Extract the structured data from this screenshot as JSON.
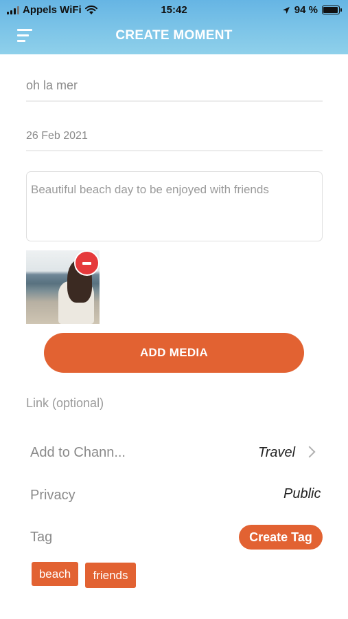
{
  "status_bar": {
    "carrier": "Appels WiFi",
    "time": "15:42",
    "battery": "94 %",
    "battery_level": 0.94
  },
  "header": {
    "title": "CREATE MOMENT",
    "menu_icon": "hamburger-menu-icon",
    "background_color": "#74bde6"
  },
  "form": {
    "title_value": "oh la mer",
    "date_value": "26 Feb 2021",
    "description_value": "Beautiful beach day to be enjoyed with friends",
    "media": {
      "thumbnail": "beach-photo",
      "remove_icon": "minus-circle-icon"
    },
    "add_media_label": "ADD MEDIA",
    "link_placeholder": "Link (optional)"
  },
  "settings": {
    "channel_label": "Add to Chann...",
    "channel_value": "Travel",
    "privacy_label": "Privacy",
    "privacy_value": "Public",
    "tag_label": "Tag",
    "create_tag_label": "Create Tag"
  },
  "tags": [
    "beach",
    "friends"
  ],
  "colors": {
    "accent": "#e26232",
    "danger": "#e5393b"
  }
}
